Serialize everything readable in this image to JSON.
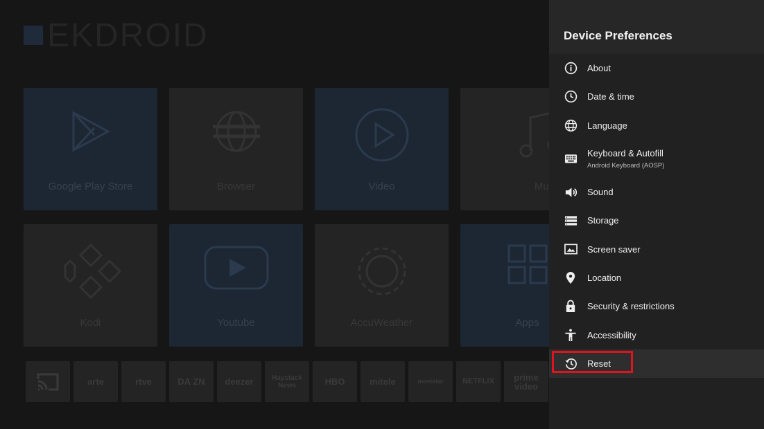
{
  "launcher": {
    "logo_text": "EKDROID",
    "tiles": [
      {
        "label": "Google Play Store",
        "icon": "play-store-icon"
      },
      {
        "label": "Browser",
        "icon": "globe-icon"
      },
      {
        "label": "Video",
        "icon": "play-circle-icon"
      },
      {
        "label": "Music",
        "icon": "music-note-icon"
      },
      {
        "label": "Kodi",
        "icon": "kodi-icon"
      },
      {
        "label": "Youtube",
        "icon": "youtube-icon"
      },
      {
        "label": "AccuWeather",
        "icon": "sun-icon"
      },
      {
        "label": "Apps",
        "icon": "apps-grid-icon"
      }
    ],
    "strip": [
      {
        "label": "",
        "icon": "cast-icon"
      },
      {
        "label": "arte"
      },
      {
        "label": "rtve"
      },
      {
        "label": "DA ZN"
      },
      {
        "label": "deezer"
      },
      {
        "label": "Haystack News"
      },
      {
        "label": "HBO"
      },
      {
        "label": "mitele"
      },
      {
        "label": "movistar"
      },
      {
        "label": "NETFLIX"
      },
      {
        "label": "prime video"
      }
    ]
  },
  "panel": {
    "title": "Device Preferences",
    "items": [
      {
        "label": "About",
        "icon": "info-icon"
      },
      {
        "label": "Date & time",
        "icon": "clock-icon"
      },
      {
        "label": "Language",
        "icon": "globe-icon"
      },
      {
        "label": "Keyboard & Autofill",
        "sublabel": "Android Keyboard (AOSP)",
        "icon": "keyboard-icon"
      },
      {
        "label": "Sound",
        "icon": "speaker-icon"
      },
      {
        "label": "Storage",
        "icon": "storage-icon"
      },
      {
        "label": "Screen saver",
        "icon": "screen-saver-icon"
      },
      {
        "label": "Location",
        "icon": "location-pin-icon"
      },
      {
        "label": "Security & restrictions",
        "icon": "lock-icon"
      },
      {
        "label": "Accessibility",
        "icon": "accessibility-icon"
      },
      {
        "label": "Reset",
        "icon": "reset-history-icon"
      }
    ],
    "highlight_color": "#e0141e"
  }
}
